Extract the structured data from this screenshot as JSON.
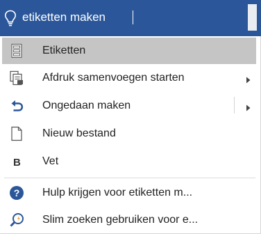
{
  "search": {
    "query": "etiketten maken",
    "icon": "lightbulb-icon"
  },
  "colors": {
    "bar": "#2b579a",
    "selected_row": "#c5c5c5",
    "undo_blue": "#2b579a",
    "help_blue": "#2b579a"
  },
  "items": [
    {
      "label": "Etiketten",
      "icon": "labels-icon",
      "selected": true
    },
    {
      "label": "Afdruk samenvoegen starten",
      "icon": "mail-merge-icon",
      "submenu": true
    },
    {
      "label": "Ongedaan maken",
      "icon": "undo-icon",
      "submenu": true,
      "split": true
    },
    {
      "label": "Nieuw bestand",
      "icon": "new-document-icon"
    },
    {
      "label": "Vet",
      "icon": "bold-icon"
    },
    {
      "label": "Hulp krijgen voor etiketten m...",
      "icon": "help-icon"
    },
    {
      "label": "Slim zoeken gebruiken voor e...",
      "icon": "smart-lookup-icon"
    }
  ]
}
